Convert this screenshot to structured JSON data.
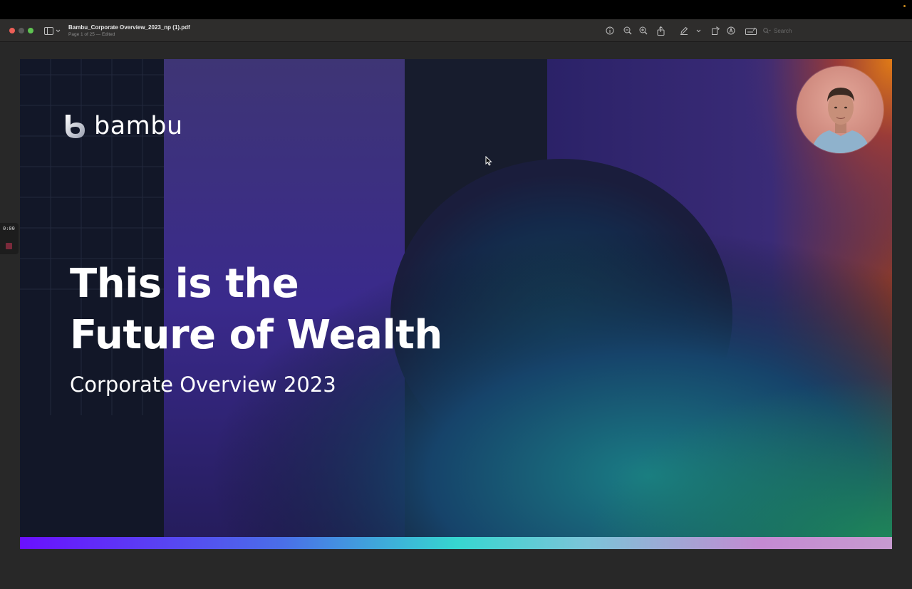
{
  "window": {
    "doc_title": "Bambu_Corporate Overview_2023_np (1).pdf",
    "doc_subtitle": "Page 1 of 25 — Edited"
  },
  "toolbar": {
    "icons": [
      "info-icon",
      "zoom-out-icon",
      "zoom-in-icon",
      "share-icon",
      "markup-pen-icon",
      "chevron-down-icon",
      "rotate-icon",
      "annotate-icon",
      "form-fill-icon",
      "search-icon"
    ],
    "search_placeholder": "Search"
  },
  "recorder": {
    "time": "0:00"
  },
  "slide": {
    "logo_text": "bambu",
    "headline_line1": "This is the",
    "headline_line2": "Future of Wealth",
    "subheading": "Corporate Overview 2023",
    "colors": {
      "bar_start": "#6a10ff",
      "bar_mid": "#36d6d0",
      "bar_end": "#c79ad0",
      "background_dark": "#111626",
      "accent_purple": "#4b2ea8",
      "accent_orange": "#d8781a"
    }
  }
}
